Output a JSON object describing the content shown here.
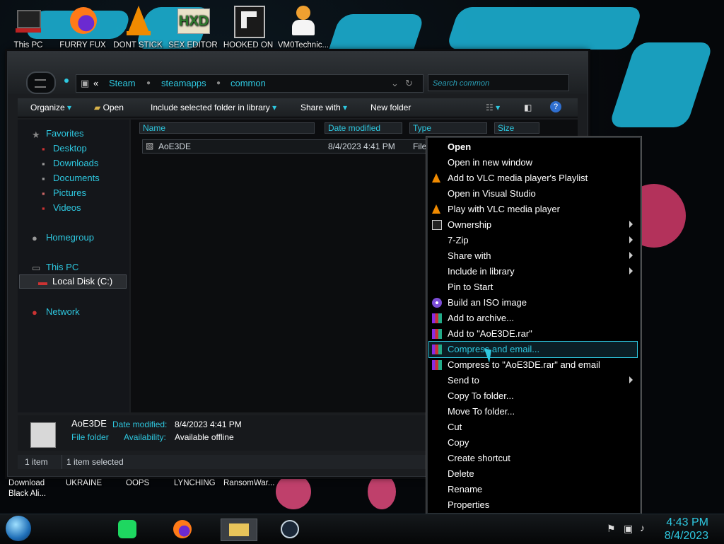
{
  "desktop": {
    "icons": [
      {
        "label": "This PC",
        "icon": "this-pc-icon"
      },
      {
        "label": "FURRY FUX",
        "icon": "firefox-icon"
      },
      {
        "label": "DONT STICK",
        "icon": "vlc-icon"
      },
      {
        "label": "SEX EDITOR",
        "icon": "hxd-icon"
      },
      {
        "label": "HOOKED ON",
        "icon": "game-icon"
      },
      {
        "label": "VM0Technic...",
        "icon": "person-icon"
      }
    ],
    "bottom_labels": [
      "Download Black Ali...",
      "UKRAINE",
      "OOPS",
      "LYNCHING",
      "RansomWar..."
    ]
  },
  "explorer": {
    "breadcrumb": [
      "«",
      "Steam",
      "steamapps",
      "common"
    ],
    "search_placeholder": "Search common",
    "toolbar": {
      "organize": "Organize",
      "open": "Open",
      "include": "Include selected folder in library",
      "share": "Share with",
      "new_folder": "New folder"
    },
    "nav": {
      "favorites": "Favorites",
      "desktop": "Desktop",
      "downloads": "Downloads",
      "documents": "Documents",
      "pictures": "Pictures",
      "videos": "Videos",
      "homegroup": "Homegroup",
      "this_pc": "This PC",
      "local_disk": "Local Disk (C:)",
      "network": "Network"
    },
    "columns": {
      "name": "Name",
      "date": "Date modified",
      "type": "Type",
      "size": "Size"
    },
    "file": {
      "name": "AoE3DE",
      "date": "8/4/2023 4:41 PM",
      "type": "File"
    },
    "details": {
      "name": "AoE3DE",
      "date_label": "Date modified:",
      "date_value": "8/4/2023 4:41 PM",
      "type": "File folder",
      "avail_label": "Availability:",
      "avail_value": "Available offline"
    },
    "status": {
      "count": "1 item",
      "selected": "1 item selected"
    }
  },
  "context_menu": [
    {
      "label": "Open",
      "bold": true,
      "icon": ""
    },
    {
      "label": "Open in new window",
      "icon": ""
    },
    {
      "label": "Add to VLC media player's Playlist",
      "icon": "vlc-icon"
    },
    {
      "label": "Open in Visual Studio",
      "icon": ""
    },
    {
      "label": "Play with VLC media player",
      "icon": "vlc-icon"
    },
    {
      "label": "Ownership",
      "icon": "cmd-icon",
      "submenu": true
    },
    {
      "label": "7-Zip",
      "icon": "",
      "submenu": true
    },
    {
      "label": "Share with",
      "icon": "",
      "submenu": true
    },
    {
      "label": "Include in library",
      "icon": "",
      "submenu": true
    },
    {
      "label": "Pin to Start",
      "icon": ""
    },
    {
      "label": "Build an ISO image",
      "icon": "iso-icon"
    },
    {
      "label": "Add to archive...",
      "icon": "winrar-icon"
    },
    {
      "label": "Add to \"AoE3DE.rar\"",
      "icon": "winrar-icon"
    },
    {
      "label": "Compress and email...",
      "icon": "winrar-icon",
      "highlighted": true
    },
    {
      "label": "Compress to \"AoE3DE.rar\" and email",
      "icon": "winrar-icon"
    },
    {
      "label": "Send to",
      "icon": "",
      "submenu": true
    },
    {
      "label": "Copy To folder...",
      "icon": ""
    },
    {
      "label": "Move To folder...",
      "icon": ""
    },
    {
      "label": "Cut",
      "icon": ""
    },
    {
      "label": "Copy",
      "icon": ""
    },
    {
      "label": "Create shortcut",
      "icon": ""
    },
    {
      "label": "Delete",
      "icon": ""
    },
    {
      "label": "Rename",
      "icon": ""
    },
    {
      "label": "Properties",
      "icon": ""
    }
  ],
  "taskbar": {
    "time": "4:43 PM",
    "date": "8/4/2023",
    "items": [
      "start-orb-icon",
      "spotify-icon",
      "firefox-icon",
      "file-explorer-icon",
      "steam-icon"
    ]
  },
  "colors": {
    "accent": "#2ec8e0",
    "highlight": "#2ec8e0"
  }
}
